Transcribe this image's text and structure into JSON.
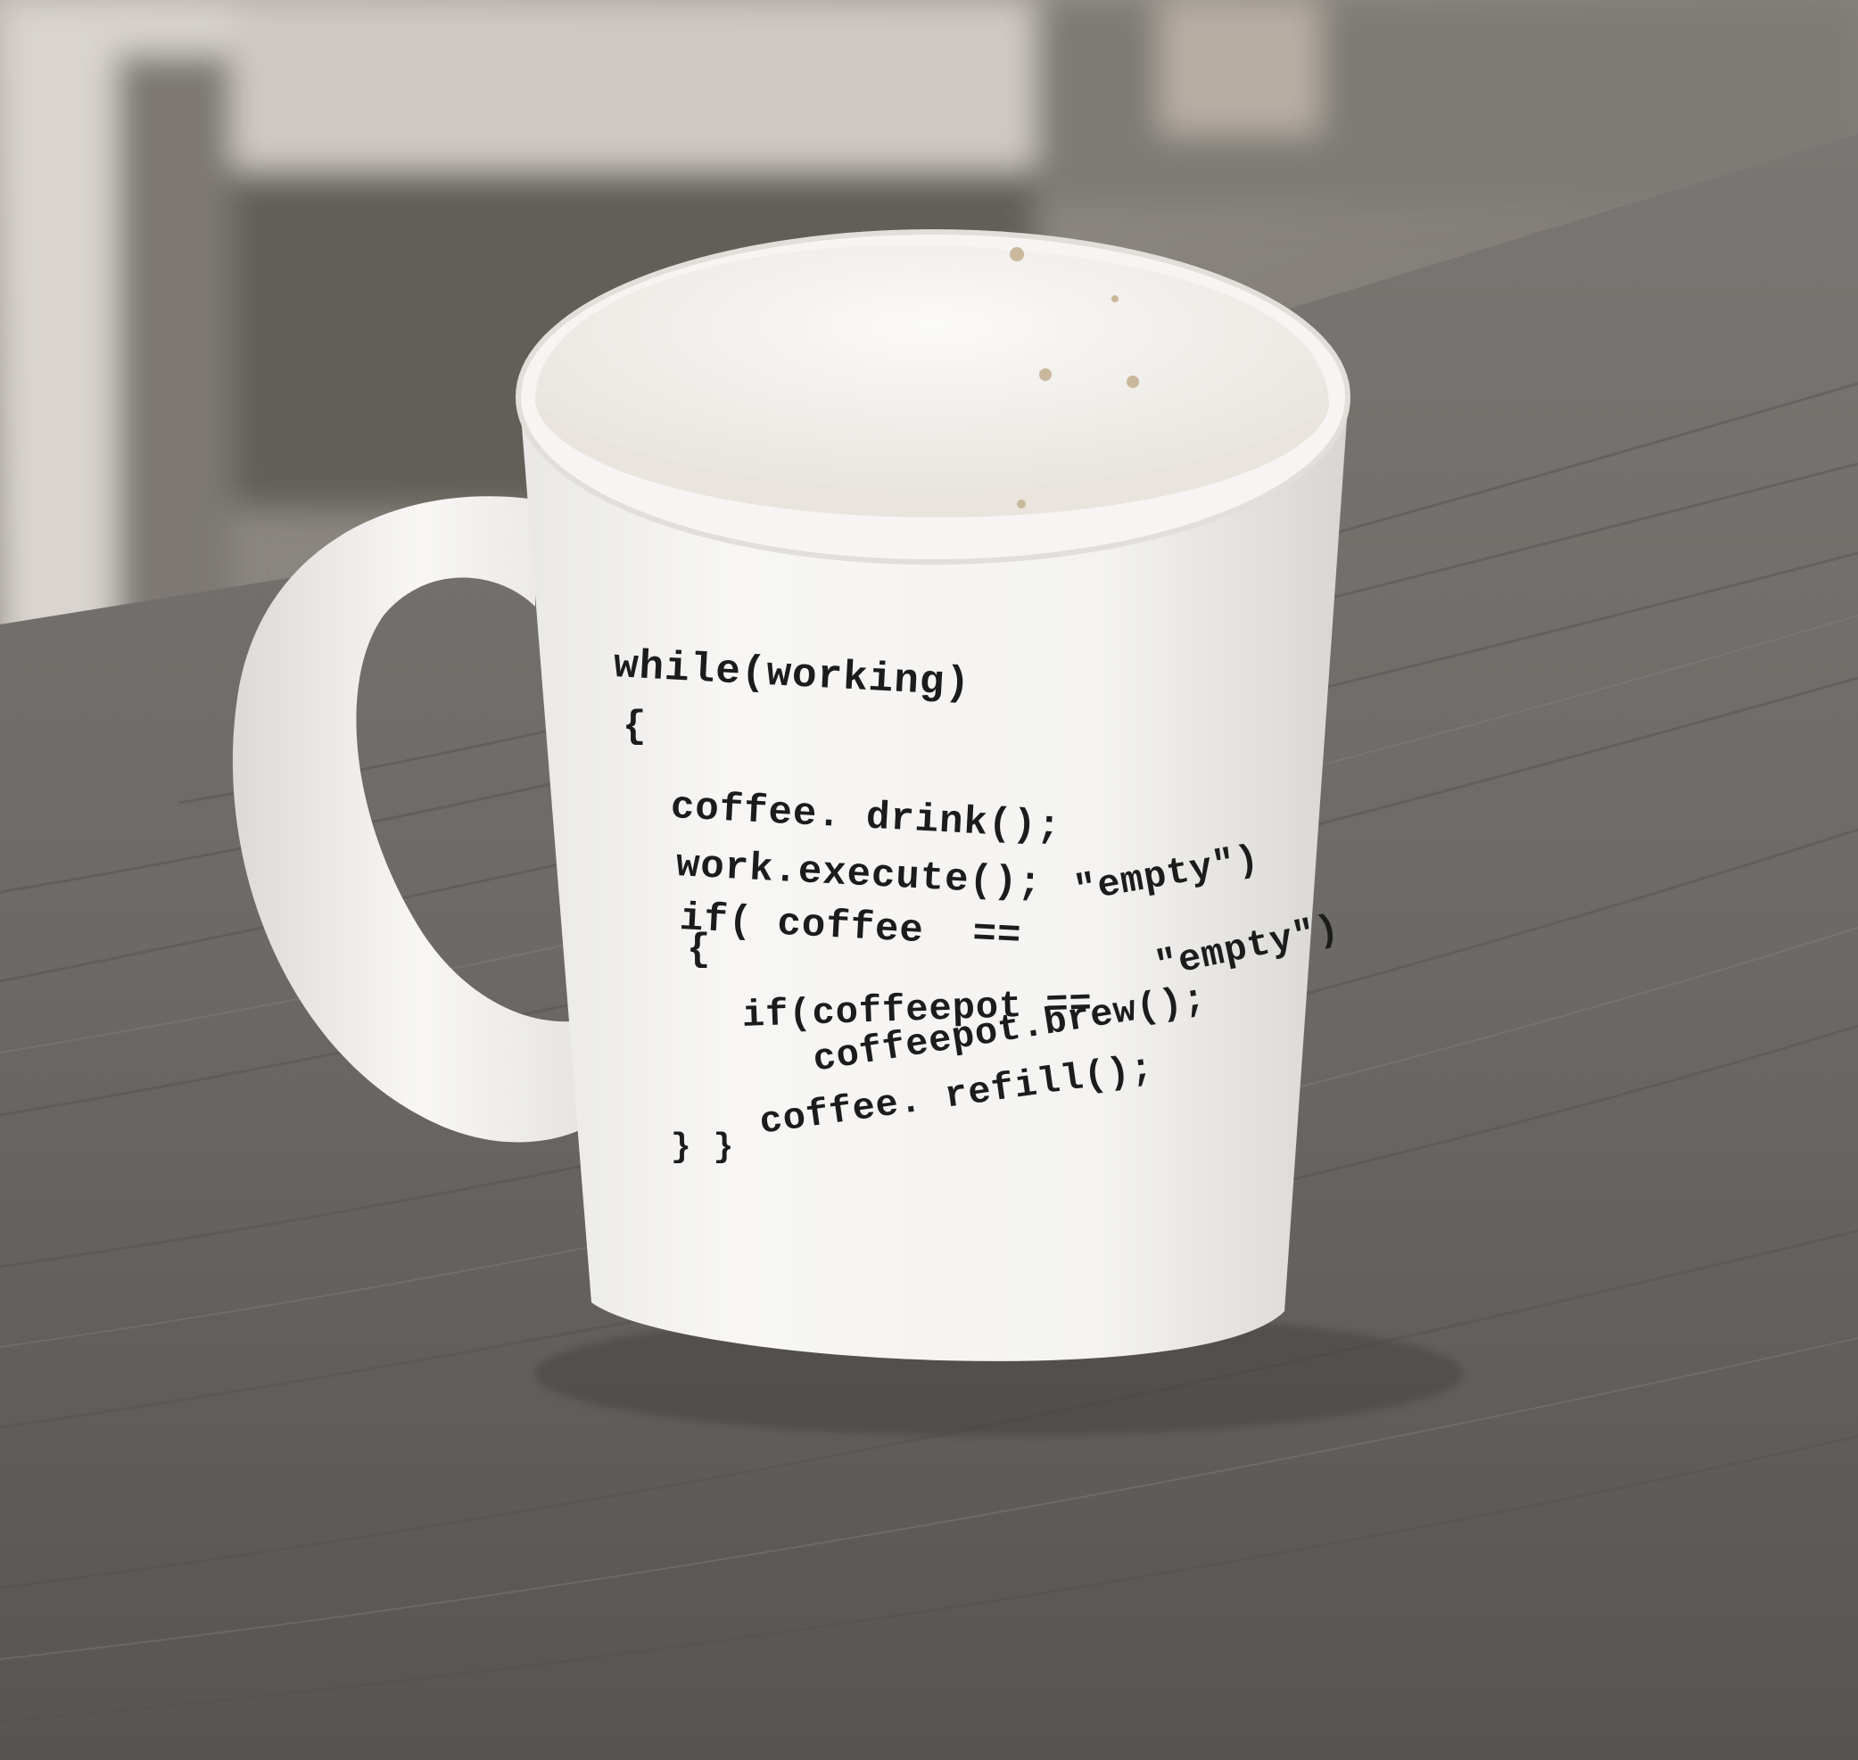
{
  "colors": {
    "table": "#6e6b68",
    "table_dark": "#5b5855",
    "wall": "#8a857f",
    "mug": "#f4f3f1",
    "mug_shadow": "#cfcdca",
    "ink": "#1c1c1c"
  },
  "mug": {
    "code_lines": [
      "while(working)",
      "{",
      "coffee. drink();",
      "work.execute();",
      "if( coffee  ==",
      "\"empty\")",
      "{",
      "if(coffeepot ==",
      "\"empty\")",
      "coffeepot.brew();",
      "coffee. refill();",
      "} }"
    ]
  }
}
